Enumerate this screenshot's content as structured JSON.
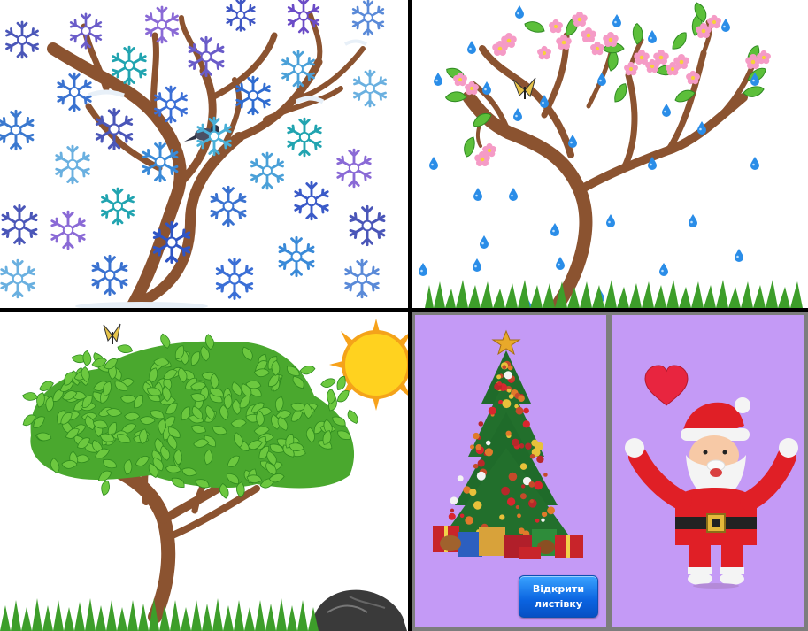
{
  "colors": {
    "trunk": "#8b5330",
    "card_background": "#c49af6",
    "button": "#0a63e0",
    "leaf": "#5cbf3a",
    "sky_drop": "#2a8de8"
  },
  "icons": {
    "winter": [
      "snowflake-icon",
      "bird-icon",
      "tree-icon"
    ],
    "spring": [
      "blossom-icon",
      "water-drop-icon",
      "butterfly-icon",
      "grass-icon"
    ],
    "summer": [
      "sun-icon",
      "butterfly-icon",
      "rock-icon",
      "grass-icon"
    ],
    "christmas": [
      "christmas-tree-icon",
      "star-icon",
      "heart-icon",
      "santa-icon"
    ]
  },
  "christmas": {
    "open_card_button": "Відкрити листівку"
  }
}
